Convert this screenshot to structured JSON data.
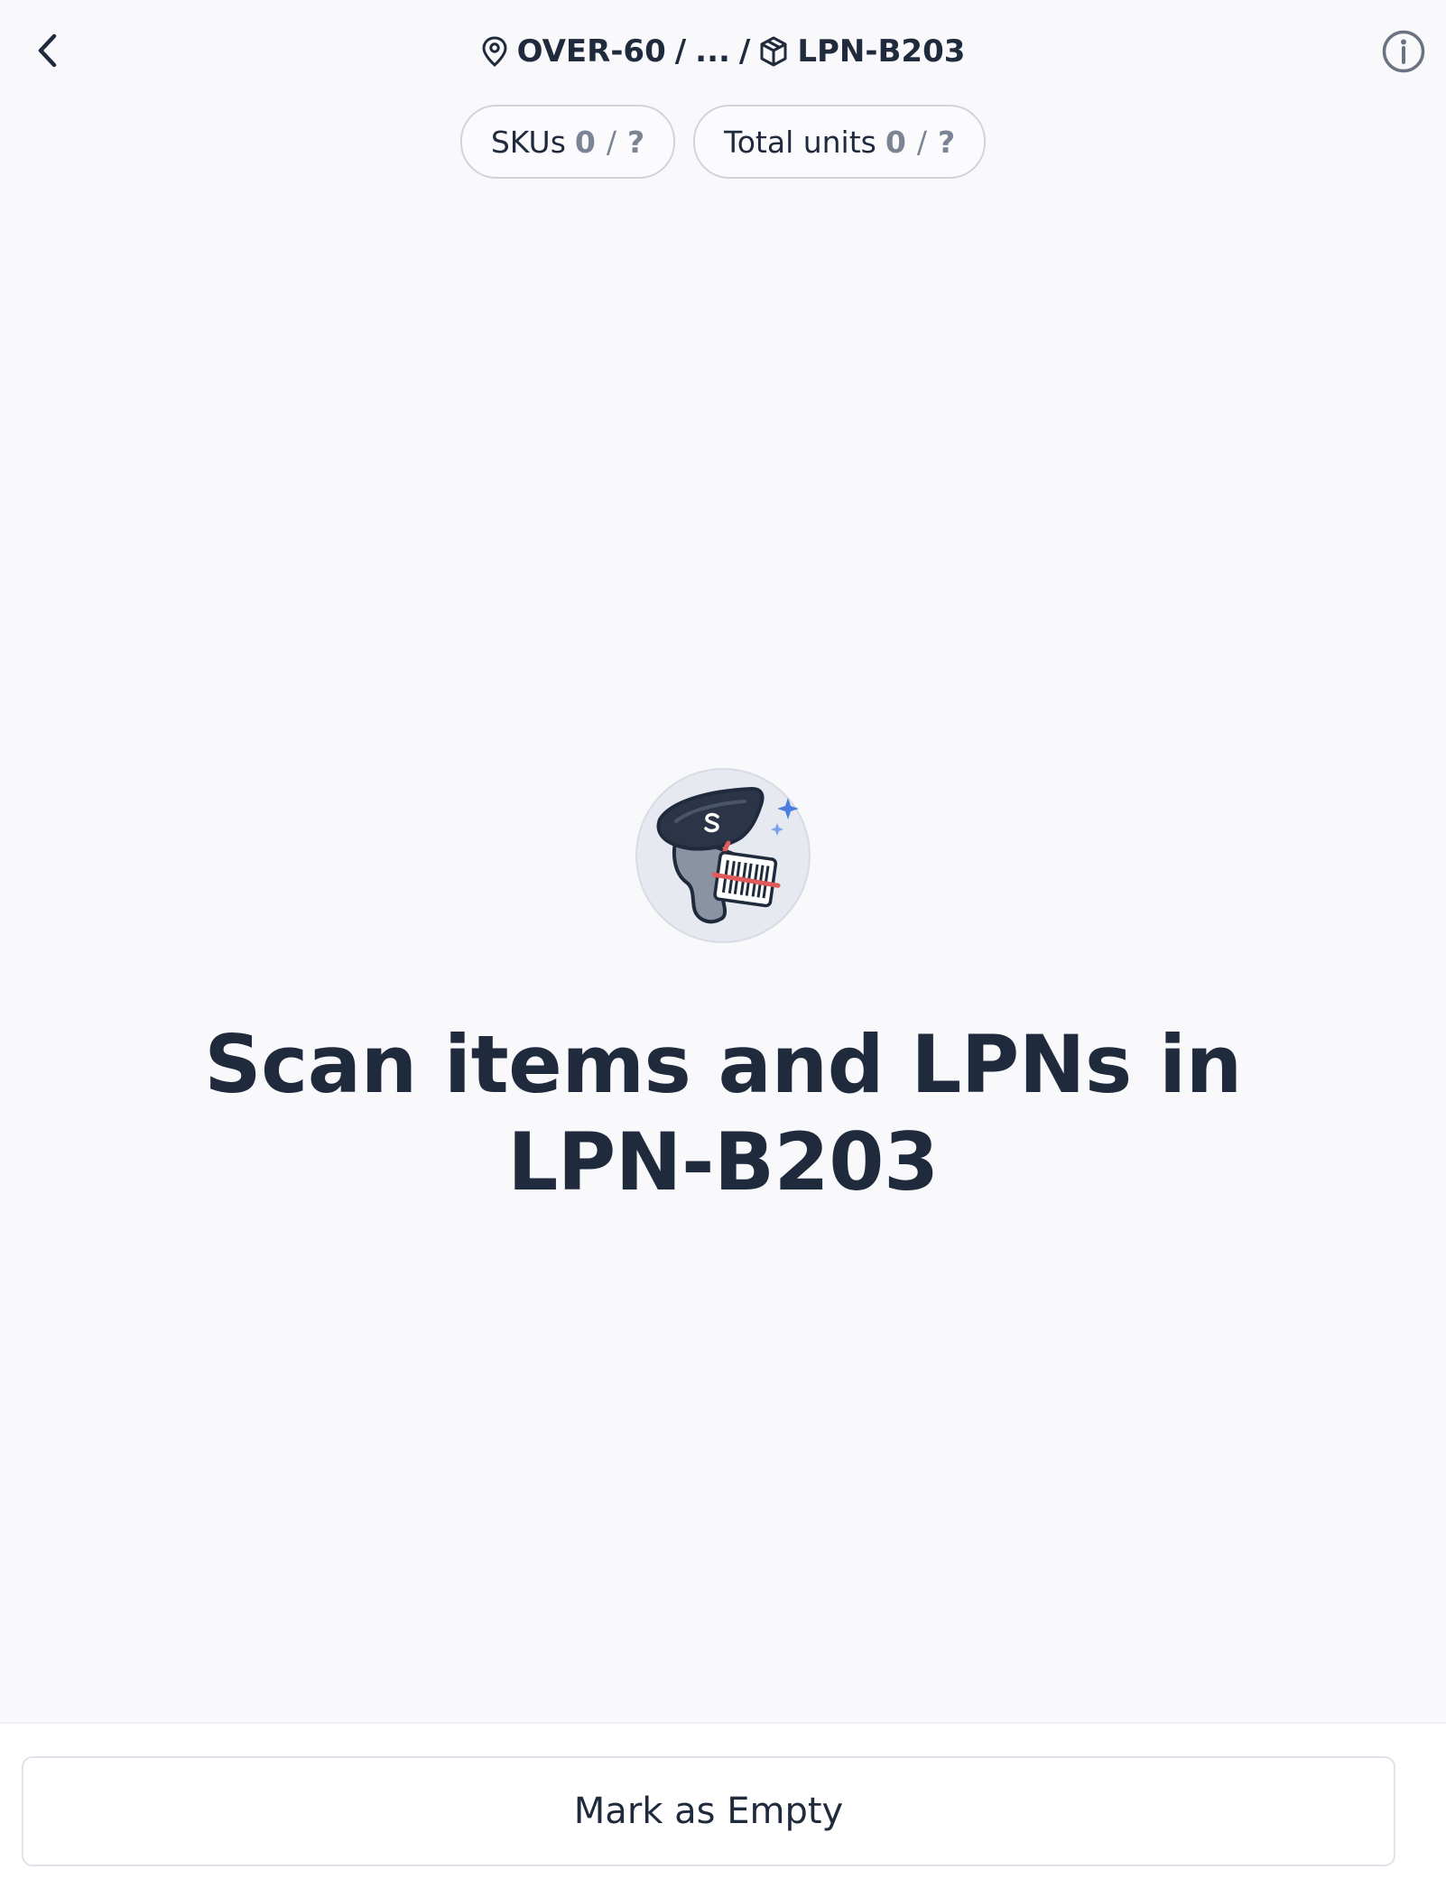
{
  "header": {
    "breadcrumb": {
      "location": "OVER-60",
      "separator": "/",
      "ellipsis": "...",
      "container": "LPN-B203"
    },
    "back_icon": "chevron-left-icon",
    "info_icon": "info-circle-icon"
  },
  "stats": {
    "skus": {
      "label": "SKUs",
      "count": "0",
      "separator": "/",
      "total": "?"
    },
    "units": {
      "label": "Total units",
      "count": "0",
      "separator": "/",
      "total": "?"
    }
  },
  "main": {
    "illustration": "barcode-scanner-icon",
    "headline_line1": "Scan items and LPNs in",
    "headline_line2": "LPN-B203"
  },
  "footer": {
    "mark_empty_label": "Mark as Empty"
  },
  "colors": {
    "background": "#f9f9fb",
    "text": "#1f2a3c",
    "muted": "#7b8494",
    "border": "#cfd4dc",
    "accent": "#4a7fe0"
  }
}
